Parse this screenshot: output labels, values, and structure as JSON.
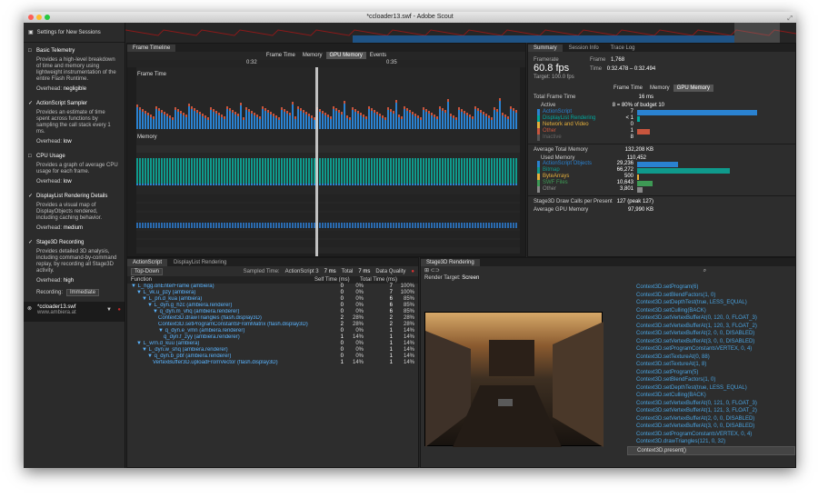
{
  "window_title": "*ccloader13.swf - Adobe Scout",
  "settings": {
    "header": "Settings for New Sessions",
    "options": [
      {
        "checked": false,
        "title": "Basic Telemetry",
        "desc": "Provides a high-level breakdown of time and memory using lightweight instrumentation of the entire Flash Runtime.",
        "overhead_label": "Overhead:",
        "overhead": "negligible"
      },
      {
        "checked": true,
        "title": "ActionScript Sampler",
        "desc": "Provides an estimate of time spent across functions by sampling the call stack every 1 ms.",
        "overhead_label": "Overhead:",
        "overhead": "low"
      },
      {
        "checked": false,
        "title": "CPU Usage",
        "desc": "Provides a graph of average CPU usage for each frame.",
        "overhead_label": "Overhead:",
        "overhead": "low"
      },
      {
        "checked": true,
        "title": "DisplayList Rendering Details",
        "desc": "Provides a visual map of DisplayObjects rendered, including caching behavior.",
        "overhead_label": "Overhead:",
        "overhead": "medium"
      },
      {
        "checked": true,
        "title": "Stage3D Recording",
        "desc": "Provides detailed 3D analysis, including command-by-command replay, by recording all Stage3D activity.",
        "overhead_label": "Overhead:",
        "overhead": "high"
      }
    ],
    "recording_label": "Recording:",
    "recording_value": "Immediate"
  },
  "session": {
    "name": "*ccloader13.swf",
    "url": "www.ambiera.at"
  },
  "timeline": {
    "tab": "Frame Timeline",
    "modes": [
      "Frame Time",
      "Memory",
      "GPU Memory",
      "Events"
    ],
    "ticks": [
      "0:32",
      "0:35"
    ],
    "lane1": "Frame Time",
    "lane2": "Memory"
  },
  "summary": {
    "tabs": [
      "Summary",
      "Session Info",
      "Trace Log"
    ],
    "framerate_label": "Framerate",
    "fps": "60.8 fps",
    "target": "Target: 100.0 fps",
    "frame_label": "Frame",
    "frame": "1,768",
    "time_label": "Time",
    "time": "0:32.478 – 0:32.494",
    "modes": [
      "Frame Time",
      "Memory",
      "GPU Memory"
    ],
    "total_frame_time_label": "Total Frame Time",
    "total_frame_time": "16 ms",
    "active_label": "Active",
    "active": "8 = 80% of budget 10",
    "rows": [
      {
        "name": "ActionScript",
        "val": "7",
        "color": "#2a82d1",
        "frac": 0.88
      },
      {
        "name": "DisplayList Rendering",
        "val": "< 1",
        "color": "#00a79d",
        "frac": 0.02
      },
      {
        "name": "Network and Video",
        "val": "0",
        "color": "#e5b03c",
        "frac": 0
      },
      {
        "name": "Other",
        "val": "1",
        "color": "#c8553d",
        "frac": 0.09
      },
      {
        "name": "Inactive",
        "val": "8",
        "color": "#555555",
        "frac": 0
      }
    ],
    "avg_mem_label": "Average Total Memory",
    "avg_mem": "132,208 KB",
    "used_mem_label": "Used Memory",
    "used_mem": "110,452",
    "mem_rows": [
      {
        "name": "ActionScript Objects",
        "val": "29,236",
        "color": "#2a82d1",
        "frac": 0.3
      },
      {
        "name": "Bitmap",
        "val": "66,272",
        "color": "#0f9a8c",
        "frac": 0.68
      },
      {
        "name": "ByteArrays",
        "val": "500",
        "color": "#e5b03c",
        "frac": 0.01
      },
      {
        "name": "SWF Files",
        "val": "10,643",
        "color": "#3e9a55",
        "frac": 0.11
      },
      {
        "name": "Other",
        "val": "3,801",
        "color": "#888888",
        "frac": 0.04
      }
    ],
    "draw_calls_label": "Stage3D Draw Calls per Present",
    "draw_calls": "127 (peak 127)",
    "gpu_mem_label": "Average GPU Memory",
    "gpu_mem": "97,990 KB"
  },
  "actionscript": {
    "tabs": [
      "ActionScript",
      "DisplayList Rendering"
    ],
    "view": "Top-Down",
    "sampled_label": "Sampled Time:",
    "sampled_name": "ActionScript 3",
    "sampled_val": "7 ms",
    "total_label": "Total",
    "total_val": "7 ms",
    "quality_label": "Data Quality",
    "cols": [
      "Function",
      "Self Time (ms)",
      "Total Time (ms)"
    ],
    "rows": [
      {
        "d": 0,
        "name": "▼ L_hgg.onEnterFrame (ambiera)",
        "s": "0",
        "sp": "0%",
        "t": "7",
        "tp": "100%"
      },
      {
        "d": 1,
        "name": "▼ L_vk.u_pzy (ambiera)",
        "s": "0",
        "sp": "0%",
        "t": "7",
        "tp": "100%"
      },
      {
        "d": 2,
        "name": "▼ L_pn.d_kua (ambiera)",
        "s": "0",
        "sp": "0%",
        "t": "6",
        "tp": "85%"
      },
      {
        "d": 3,
        "name": "▼ L_dyn.g_hzc (ambiera.renderer)",
        "s": "0",
        "sp": "0%",
        "t": "6",
        "tp": "85%"
      },
      {
        "d": 4,
        "name": "▼ q_dyn.m_vhq (ambiera.renderer)",
        "s": "0",
        "sp": "0%",
        "t": "6",
        "tp": "85%"
      },
      {
        "d": 5,
        "name": "Context3D.drawTriangles (flash.display3D)",
        "s": "2",
        "sp": "28%",
        "t": "2",
        "tp": "28%"
      },
      {
        "d": 5,
        "name": "Context3D.setProgramConstantsFromMatrix (flash.display3D)",
        "s": "2",
        "sp": "28%",
        "t": "2",
        "tp": "28%"
      },
      {
        "d": 5,
        "name": "▼ q_dyn.e_vmn (ambiera.renderer)",
        "s": "0",
        "sp": "0%",
        "t": "1",
        "tp": "14%"
      },
      {
        "d": 6,
        "name": "q_dyn.f_zyy (ambiera.renderer)",
        "s": "1",
        "sp": "14%",
        "t": "1",
        "tp": "14%"
      },
      {
        "d": 1,
        "name": "▼ L_wrn.d_kuu (ambiera)",
        "s": "0",
        "sp": "0%",
        "t": "1",
        "tp": "14%"
      },
      {
        "d": 2,
        "name": "▼ L_dyn.w_shq (ambiera.renderer)",
        "s": "0",
        "sp": "0%",
        "t": "1",
        "tp": "14%"
      },
      {
        "d": 3,
        "name": "▼ q_dyn.b_pbf (ambiera.renderer)",
        "s": "0",
        "sp": "0%",
        "t": "1",
        "tp": "14%"
      },
      {
        "d": 4,
        "name": "VertexBuffer3D.uploadFromVector (flash.display3D)",
        "s": "1",
        "sp": "14%",
        "t": "1",
        "tp": "14%"
      }
    ]
  },
  "stage3d": {
    "tab": "Stage3D Rendering",
    "render_target_label": "Render Target:",
    "render_target": "Screen",
    "calls": [
      "Context3D.setProgram(6)",
      "Context3D.setBlendFactors(1, 0)",
      "Context3D.setDepthTest(true, LESS_EQUAL)",
      "Context3D.setCulling(BACK)",
      "Context3D.setVertexBufferAt(0, 120, 0, FLOAT_3)",
      "Context3D.setVertexBufferAt(1, 120, 3, FLOAT_2)",
      "Context3D.setVertexBufferAt(2, 0, 0, DISABLED)",
      "Context3D.setVertexBufferAt(3, 0, 0, DISABLED)",
      "Context3D.setProgramConstantsVERTEX, 0, 4)",
      "Context3D.setTextureAt(0, 88)",
      "Context3D.setTextureAt(1, 8)",
      "Context3D.setProgram(5)",
      "Context3D.setBlendFactors(1, 0)",
      "Context3D.setDepthTest(true, LESS_EQUAL)",
      "Context3D.setCulling(BACK)",
      "Context3D.setVertexBufferAt(0, 121, 0, FLOAT_3)",
      "Context3D.setVertexBufferAt(1, 121, 3, FLOAT_2)",
      "Context3D.setVertexBufferAt(2, 0, 0, DISABLED)",
      "Context3D.setVertexBufferAt(3, 0, 0, DISABLED)",
      "Context3D.setProgramConstantsVERTEX, 0, 4)",
      "Context3D.drawTriangles(121, 0, 32)",
      "Context3D.present()"
    ]
  }
}
